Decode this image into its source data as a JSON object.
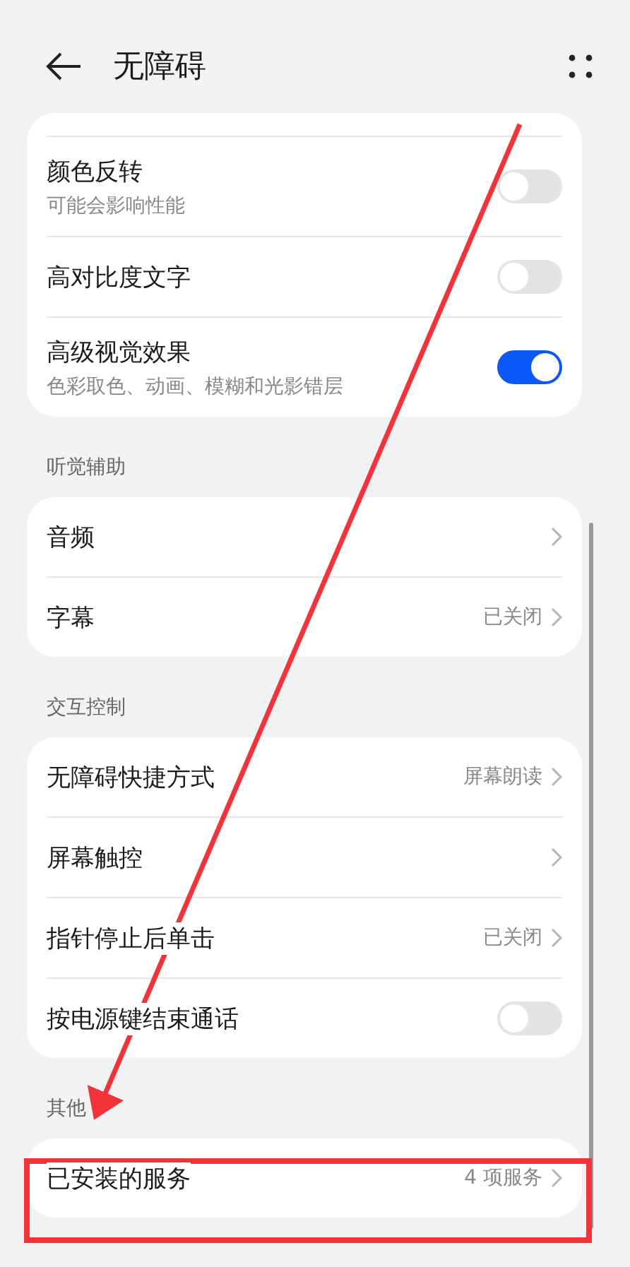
{
  "header": {
    "title": "无障碍"
  },
  "groups": [
    {
      "rows": [
        {
          "kind": "toggle",
          "label": "颜色反转",
          "subtitle": "可能会影响性能",
          "on": false
        },
        {
          "kind": "toggle",
          "label": "高对比度文字",
          "on": false
        },
        {
          "kind": "toggle",
          "label": "高级视觉效果",
          "subtitle": "色彩取色、动画、模糊和光影错层",
          "on": true
        }
      ]
    },
    {
      "title": "听觉辅助",
      "rows": [
        {
          "kind": "link",
          "label": "音频"
        },
        {
          "kind": "link",
          "label": "字幕",
          "value": "已关闭"
        }
      ]
    },
    {
      "title": "交互控制",
      "rows": [
        {
          "kind": "link",
          "label": "无障碍快捷方式",
          "value": "屏幕朗读"
        },
        {
          "kind": "link",
          "label": "屏幕触控"
        },
        {
          "kind": "link",
          "label": "指针停止后单击",
          "value": "已关闭"
        },
        {
          "kind": "toggle",
          "label": "按电源键结束通话",
          "on": false
        }
      ]
    },
    {
      "title": "其他",
      "rows": [
        {
          "kind": "link",
          "label": "已安装的服务",
          "value": "4 项服务"
        }
      ]
    }
  ]
}
